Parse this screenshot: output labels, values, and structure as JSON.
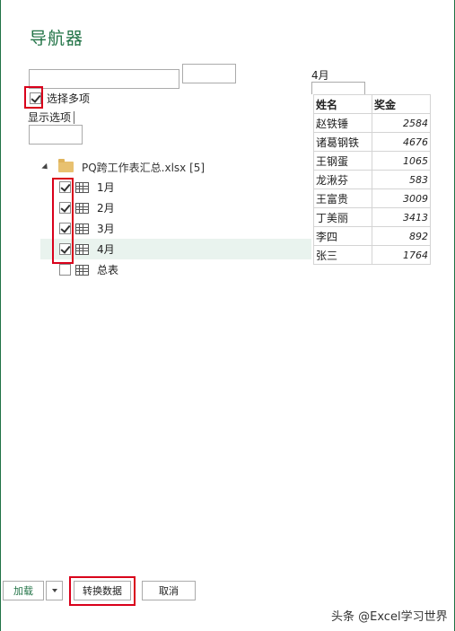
{
  "title": "导航器",
  "search": {
    "value": "",
    "placeholder": ""
  },
  "multi_select": {
    "label": "选择多项",
    "checked": true
  },
  "display_options": {
    "label": "显示选项"
  },
  "tree": {
    "root": {
      "label": "PQ跨工作表汇总.xlsx [5]",
      "icon": "folder-icon"
    },
    "items": [
      {
        "label": "1月",
        "checked": true,
        "icon": "sheet-icon"
      },
      {
        "label": "2月",
        "checked": true,
        "icon": "sheet-icon"
      },
      {
        "label": "3月",
        "checked": true,
        "icon": "sheet-icon"
      },
      {
        "label": "4月",
        "checked": true,
        "icon": "sheet-icon",
        "selected": true
      },
      {
        "label": "总表",
        "checked": false,
        "icon": "sheet-icon"
      }
    ]
  },
  "preview": {
    "title": "4月",
    "columns": [
      "姓名",
      "奖金"
    ],
    "rows": [
      [
        "赵铁锤",
        "2584"
      ],
      [
        "诸葛钢铁",
        "4676"
      ],
      [
        "王钢蛋",
        "1065"
      ],
      [
        "龙湫芬",
        "583"
      ],
      [
        "王富贵",
        "3009"
      ],
      [
        "丁美丽",
        "3413"
      ],
      [
        "李四",
        "892"
      ],
      [
        "张三",
        "1764"
      ]
    ]
  },
  "buttons": {
    "load": "加载",
    "transform": "转换数据",
    "cancel": "取消"
  },
  "watermark": "头条 @Excel学习世界",
  "colors": {
    "accent": "#217346",
    "highlight": "#d9001b",
    "selected_row": "#e9f3ee"
  }
}
